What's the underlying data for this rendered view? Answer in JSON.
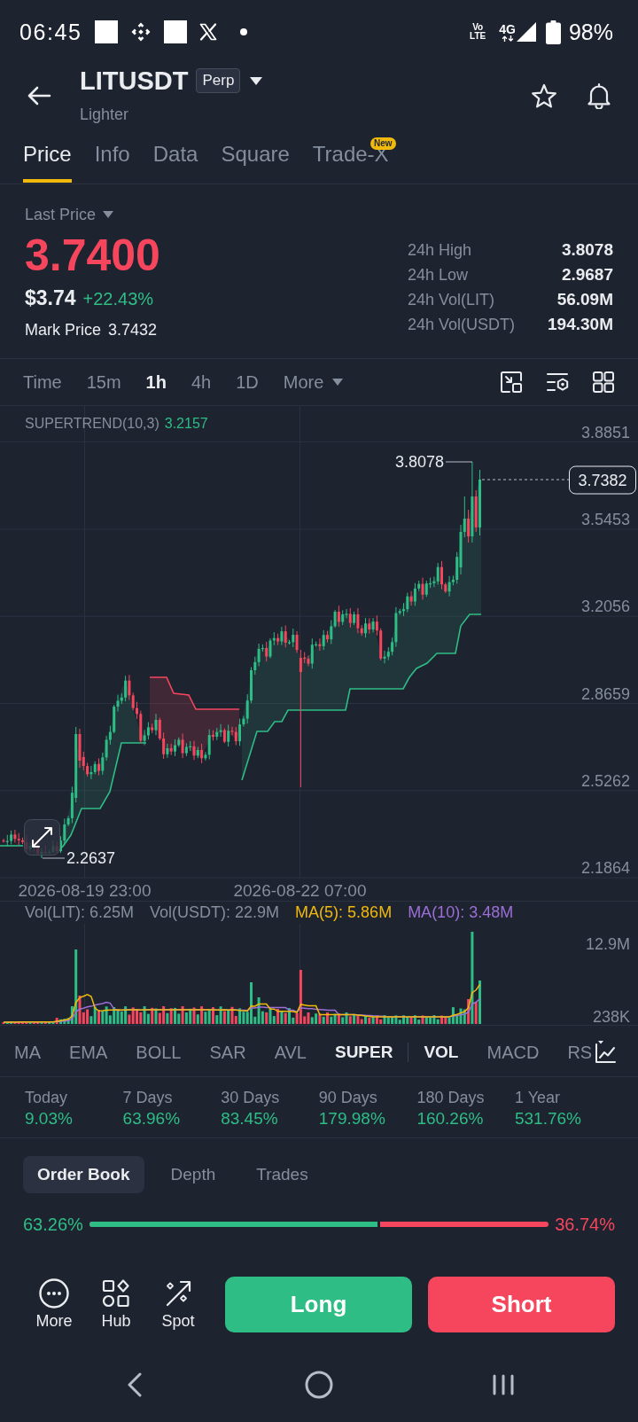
{
  "status_bar": {
    "time": "06:45",
    "volte": [
      "Vo",
      "LTE"
    ],
    "network": "4G",
    "battery": "98%"
  },
  "header": {
    "symbol": "LITUSDT",
    "badge": "Perp",
    "subtitle": "Lighter"
  },
  "tabs": [
    {
      "label": "Price",
      "selected": true
    },
    {
      "label": "Info",
      "selected": false
    },
    {
      "label": "Data",
      "selected": false
    },
    {
      "label": "Square",
      "selected": false
    },
    {
      "label": "Trade-X",
      "selected": false,
      "badge": "New"
    }
  ],
  "price": {
    "selector": "Last Price",
    "last": "3.7400",
    "down_tick": true,
    "usd": "$3.74",
    "change": "+22.43%",
    "mark_label": "Mark Price",
    "mark_value": "3.7432"
  },
  "stats": [
    {
      "label": "24h High",
      "value": "3.8078"
    },
    {
      "label": "24h Low",
      "value": "2.9687"
    },
    {
      "label": "24h Vol(LIT)",
      "value": "56.09M"
    },
    {
      "label": "24h Vol(USDT)",
      "value": "194.30M"
    }
  ],
  "timeframes": [
    {
      "label": "Time",
      "selected": false,
      "kind": "interval"
    },
    {
      "label": "15m",
      "selected": false,
      "kind": "interval"
    },
    {
      "label": "1h",
      "selected": true,
      "kind": "interval"
    },
    {
      "label": "4h",
      "selected": false,
      "kind": "interval"
    },
    {
      "label": "1D",
      "selected": false,
      "kind": "interval"
    },
    {
      "label": "More",
      "selected": false,
      "kind": "menu"
    }
  ],
  "chart": {
    "indicator": "SUPERTREND(10,3)",
    "indicator_value": "3.2157",
    "y_ticks": [
      "3.8851",
      "3.5453",
      "3.2056",
      "2.8659",
      "2.5262",
      "2.1864"
    ],
    "high": "3.8078",
    "low": "2.2637",
    "last_price_tag": "3.7382",
    "x_labels": [
      "2026-08-19 23:00",
      "2026-08-22 07:00"
    ]
  },
  "volume": {
    "legend": [
      {
        "text": "Vol(LIT): 6.25M",
        "color": "#848e9c"
      },
      {
        "text": "Vol(USDT): 22.9M",
        "color": "#848e9c"
      },
      {
        "text": "MA(5): 5.86M",
        "color": "#f0b90b"
      },
      {
        "text": "MA(10): 3.48M",
        "color": "#9b6fd6"
      }
    ],
    "y_ticks": [
      "12.9M",
      "238K"
    ]
  },
  "indicators": {
    "main": [
      {
        "label": "MA",
        "selected": false
      },
      {
        "label": "EMA",
        "selected": false
      },
      {
        "label": "BOLL",
        "selected": false
      },
      {
        "label": "SAR",
        "selected": false
      },
      {
        "label": "AVL",
        "selected": false
      },
      {
        "label": "SUPER",
        "selected": true
      }
    ],
    "sub": [
      {
        "label": "VOL",
        "selected": true
      },
      {
        "label": "MACD",
        "selected": false
      },
      {
        "label": "RS",
        "selected": false
      }
    ]
  },
  "performance": [
    {
      "period": "Today",
      "change": "9.03%"
    },
    {
      "period": "7 Days",
      "change": "63.96%"
    },
    {
      "period": "30 Days",
      "change": "83.45%"
    },
    {
      "period": "90 Days",
      "change": "179.98%"
    },
    {
      "period": "180 Days",
      "change": "160.26%"
    },
    {
      "period": "1 Year",
      "change": "531.76%"
    }
  ],
  "order_book": {
    "tabs": [
      {
        "label": "Order Book",
        "selected": true
      },
      {
        "label": "Depth",
        "selected": false
      },
      {
        "label": "Trades",
        "selected": false
      }
    ],
    "bid_share": "63.26%",
    "ask_share": "36.74%",
    "level": 0.6326
  },
  "action_bar": {
    "items": [
      {
        "label": "More"
      },
      {
        "label": "Hub"
      },
      {
        "label": "Spot"
      }
    ],
    "long": "Long",
    "short": "Short"
  }
}
